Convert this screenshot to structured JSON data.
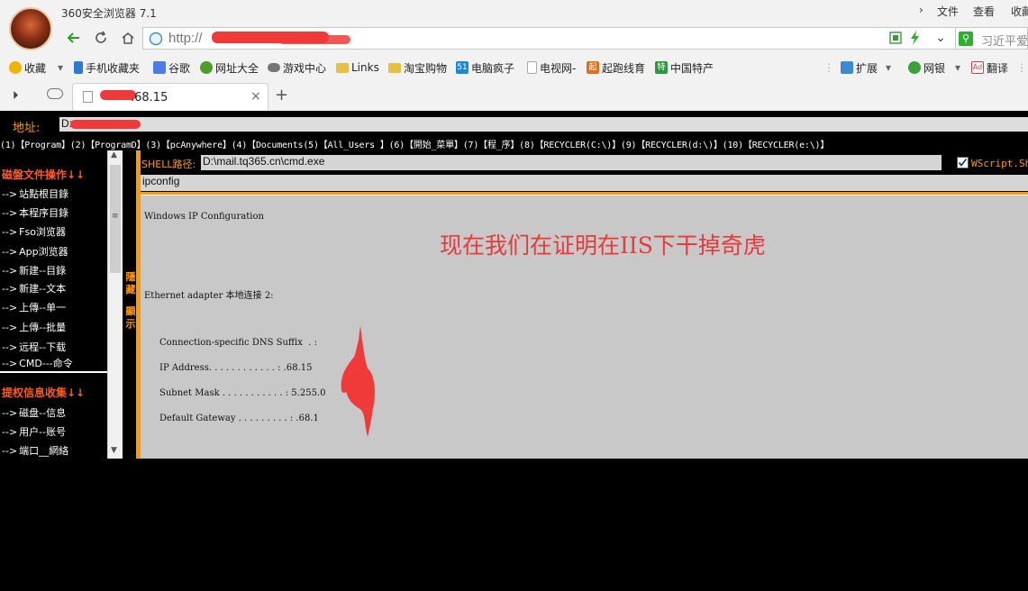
{
  "browser": {
    "app_title": "360安全浏览器 7.1",
    "menu": {
      "file": "文件",
      "view": "查看",
      "favorites": "收藏"
    },
    "address_prefix": "http://",
    "search_text": "习近平爱",
    "tab_title": ".68.15"
  },
  "bookmarks": [
    {
      "label": "收藏",
      "icon": "star-icon",
      "color": "#f0b400"
    },
    {
      "label": "手机收藏夹",
      "icon": "phone-icon",
      "color": "#2a7bd6"
    },
    {
      "label": "谷歌",
      "icon": "google-icon",
      "color": "#4a7de8"
    },
    {
      "label": "网址大全",
      "icon": "globe-icon",
      "color": "#4a9f2a"
    },
    {
      "label": "游戏中心",
      "icon": "gamepad-icon",
      "color": "#777777"
    },
    {
      "label": "Links",
      "icon": "folder-icon",
      "color": "#e8c040"
    },
    {
      "label": "淘宝购物",
      "icon": "folder-icon",
      "color": "#e8c040"
    },
    {
      "label": "电脑疯子",
      "icon": "51-icon",
      "color": "#1a8ad6"
    },
    {
      "label": "电视网-",
      "icon": "page-icon",
      "color": "#bbbbbb"
    },
    {
      "label": "起跑线育",
      "icon": "qi-icon",
      "color": "#e07020"
    },
    {
      "label": "中国特产",
      "icon": "te-icon",
      "color": "#2a9a3a"
    },
    {
      "label": "扩展",
      "icon": "extension-icon",
      "color": "#3a8ad6"
    },
    {
      "label": "网银",
      "icon": "shield-icon",
      "color": "#3aa03a"
    },
    {
      "label": "翻译",
      "icon": "translate-icon",
      "color": "#d04040"
    }
  ],
  "page": {
    "path_label": "地址:",
    "path_value": "D:",
    "quick_links": "(1)【Program】(2)【ProgramD】(3)【pcAnywhere】(4)【Documents(5)【All_Users 】(6)【開始_菜單】(7)【程_序】(8)【RECYCLER(C:\\)】(9)【RECYCLER(d:\\)】(10)【RECYCLER(e:\\)】",
    "sidebar": {
      "disk_heading": "磁盤文件操作↓↓",
      "disk_items": [
        "站點根目錄",
        "本程序目錄",
        "Fso浏览器",
        "App浏览器",
        "新建--目錄",
        "新建--文本",
        "上傳--单一",
        "上傳--批量",
        "远程--下载",
        "CMD---命令"
      ],
      "priv_heading": "提权信息收集↓↓",
      "priv_items": [
        "磁盘--信息",
        "用户--账号",
        "端口__網絡"
      ],
      "arrow": "-->"
    },
    "toggle_text": [
      "隱",
      "藏",
      "",
      "顯",
      "示"
    ],
    "shell_label": "SHELL路径:",
    "shell_path": "D:\\mail.tq365.cn\\cmd.exe",
    "wscript_label": "WScript.Shell",
    "command": "ipconfig",
    "output": [
      "Windows IP Configuration",
      "Ethernet adapter 本地连接 2:",
      "Connection-specific DNS Suffix  . :",
      "IP Address. . . . . . . . . . . . : .68.15",
      "Subnet Mask . . . . . . . . . . . : 5.255.0",
      "Default Gateway . . . . . . . . . : .68.1"
    ],
    "overlay_text": "现在我们在证明在IIS下干掉奇虎"
  },
  "colors": {
    "accent": "#ff9a00",
    "annotation": "#e83a3a",
    "redaction": "#f03a3a"
  }
}
